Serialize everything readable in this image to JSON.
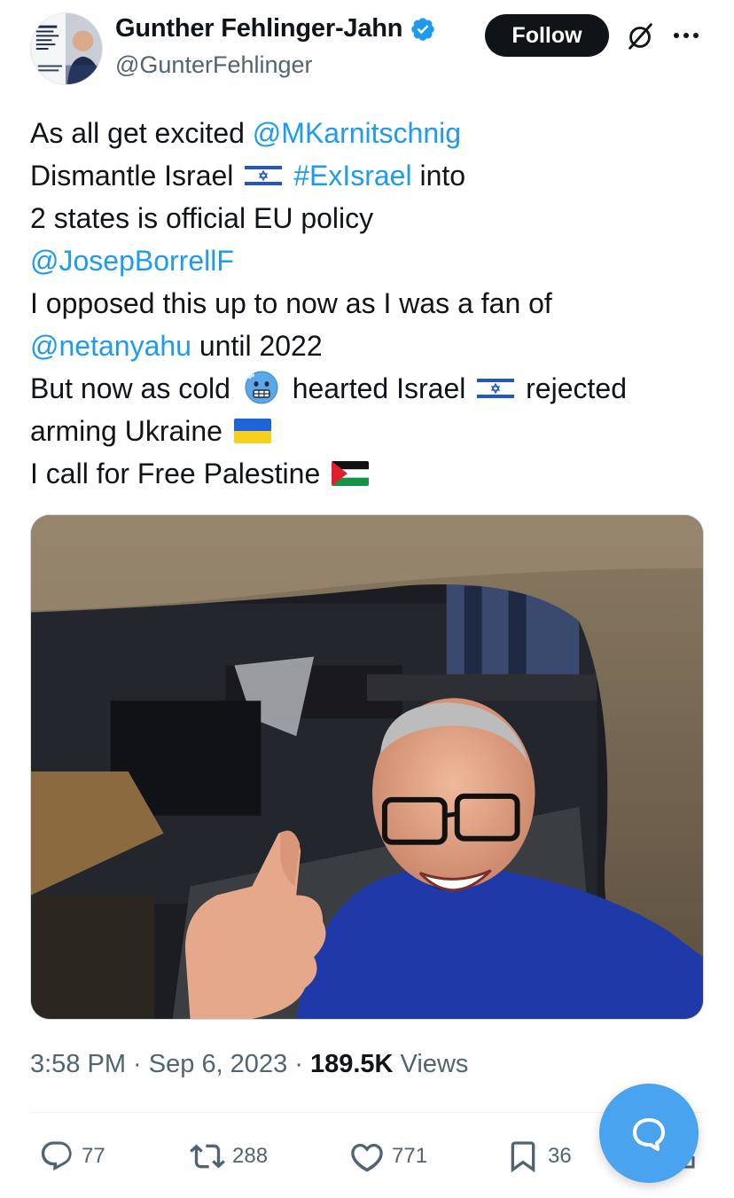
{
  "author": {
    "display_name": "Gunther Fehlinger-Jahn",
    "handle": "@GunterFehlinger",
    "verified": true
  },
  "header": {
    "follow_label": "Follow"
  },
  "tweet": {
    "lines": [
      {
        "parts": [
          {
            "t": "As all get excited "
          },
          {
            "t": "@MKarnitschnig",
            "link": true
          }
        ]
      },
      {
        "parts": [
          {
            "t": "Dismantle Israel "
          },
          {
            "flag": "israel"
          },
          {
            "t": " "
          },
          {
            "t": "#ExIsrael",
            "link": true
          },
          {
            "t": " into"
          }
        ]
      },
      {
        "parts": [
          {
            "t": "2 states is official EU policy"
          }
        ]
      },
      {
        "parts": [
          {
            "t": "@JosepBorrellF",
            "link": true
          }
        ]
      },
      {
        "parts": [
          {
            "t": "I opposed this up to now as I was a fan of"
          }
        ]
      },
      {
        "parts": [
          {
            "t": "@netanyahu",
            "link": true
          },
          {
            "t": " until 2022"
          }
        ]
      },
      {
        "parts": [
          {
            "t": "But now as cold "
          },
          {
            "emoji": "cold-face"
          },
          {
            "t": " hearted Israel "
          },
          {
            "flag": "israel"
          },
          {
            "t": " rejected"
          }
        ]
      },
      {
        "parts": [
          {
            "t": "arming Ukraine "
          },
          {
            "flag": "ukraine"
          }
        ]
      },
      {
        "parts": [
          {
            "t": "I call for Free Palestine "
          },
          {
            "flag": "palestine"
          }
        ]
      }
    ]
  },
  "meta": {
    "time": "3:58 PM",
    "separator": " · ",
    "date": "Sep 6, 2023",
    "views_count": "189.5K",
    "views_label": " Views"
  },
  "actions": {
    "replies": "77",
    "reposts": "288",
    "likes": "771",
    "bookmarks": "36"
  },
  "colors": {
    "link": "#1d9bf0",
    "text": "#0f1419",
    "muted": "#536471",
    "fab": "#4aa3ee",
    "verified": "#1d9bf0"
  },
  "icons": {
    "verified": "verified-badge-icon",
    "grok": "grok-icon",
    "more": "more-dots-icon",
    "reply": "reply-icon",
    "repost": "repost-icon",
    "like": "heart-icon",
    "bookmark": "bookmark-icon",
    "compose": "message-bubble-icon"
  }
}
